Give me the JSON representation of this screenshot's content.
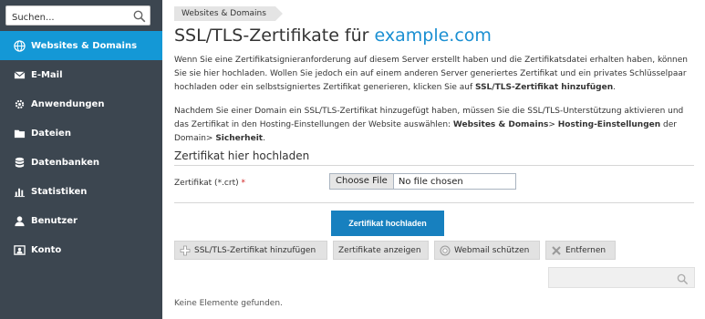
{
  "sidebar": {
    "search_placeholder": "Suchen...",
    "items": [
      {
        "label": "Websites & Domains",
        "icon": "globe-icon",
        "active": true
      },
      {
        "label": "E-Mail",
        "icon": "envelope-icon"
      },
      {
        "label": "Anwendungen",
        "icon": "gear-icon"
      },
      {
        "label": "Dateien",
        "icon": "folder-icon"
      },
      {
        "label": "Datenbanken",
        "icon": "database-icon"
      },
      {
        "label": "Statistiken",
        "icon": "bar-chart-icon"
      },
      {
        "label": "Benutzer",
        "icon": "user-icon"
      },
      {
        "label": "Konto",
        "icon": "account-icon"
      }
    ]
  },
  "breadcrumb": "Websites & Domains",
  "title": {
    "prefix": "SSL/TLS-Zertifikate für ",
    "domain": "example.com"
  },
  "intro": {
    "text": "Wenn Sie eine Zertifikatsignieranforderung auf diesem Server erstellt haben und die Zertifikatsdatei erhalten haben, können Sie sie hier hochladen. Wollen Sie jedoch ein auf einem anderen Server generiertes Zertifikat und ein privates Schlüsselpaar hochladen oder ein selbstsigniertes Zertifikat generieren, klicken Sie auf ",
    "bold": "SSL/TLS-Zertifikat hinzufügen",
    "end": "."
  },
  "intro2": {
    "text": "Nachdem Sie einer Domain ein SSL/TLS-Zertifikat hinzugefügt haben, müssen Sie die SSL/TLS-Unterstützung aktivieren und das Zertifikat in den Hosting-Einstellungen der Website auswählen: ",
    "path1": "Websites & Domains",
    "sep1": "> ",
    "path2": "Hosting-Einstellungen",
    "mid": " der Domain> ",
    "path3": "Sicherheit",
    "end": "."
  },
  "upload": {
    "section_title": "Zertifikat hier hochladen",
    "field_label": "Zertifikat (*.crt)",
    "required_mark": "*",
    "choose_label": "Choose File",
    "file_status": "No file chosen",
    "submit_label": "Zertifikat hochladen"
  },
  "toolbar": {
    "add_label": "SSL/TLS-Zertifikat hinzufügen",
    "show_label": "Zertifikate anzeigen",
    "webmail_label": "Webmail schützen",
    "remove_label": "Entfernen"
  },
  "empty_message": "Keine Elemente gefunden.",
  "colors": {
    "sidebar_bg": "#3c4650",
    "active": "#1498d6",
    "primary_button": "#1780bf",
    "link": "#1a8fd2"
  }
}
